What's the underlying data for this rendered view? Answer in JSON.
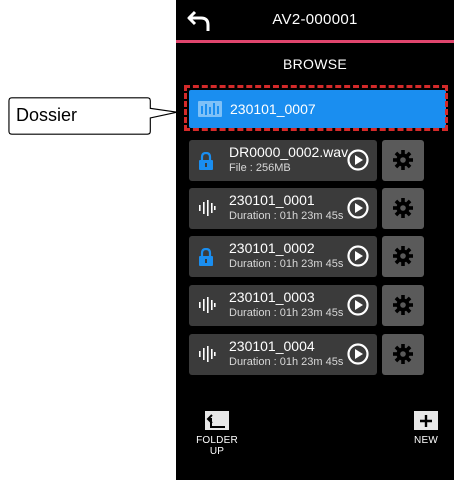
{
  "header": {
    "title": "AV2-000001"
  },
  "section_title": "BROWSE",
  "folder": {
    "name": "230101_0007"
  },
  "callout_label": "Dossier",
  "items": [
    {
      "name": "DR0000_0002.wav",
      "detail": "File : 256MB",
      "icon": "lock-icon"
    },
    {
      "name": "230101_0001",
      "detail": "Duration : 01h 23m 45s",
      "icon": "waveform-icon"
    },
    {
      "name": "230101_0002",
      "detail": "Duration : 01h 23m 45s",
      "icon": "lock-icon"
    },
    {
      "name": "230101_0003",
      "detail": "Duration : 01h 23m 45s",
      "icon": "waveform-icon"
    },
    {
      "name": "230101_0004",
      "detail": "Duration : 01h 23m 45s",
      "icon": "waveform-icon"
    }
  ],
  "bottom": {
    "folder_up_label": "FOLDER UP",
    "new_label": "NEW"
  },
  "colors": {
    "accent": "#1a8ef0",
    "header_rule": "#e0466e",
    "highlight": "#d42a2a",
    "row_bg": "#3b3b3b",
    "gear_bg": "#5a5a5a"
  }
}
